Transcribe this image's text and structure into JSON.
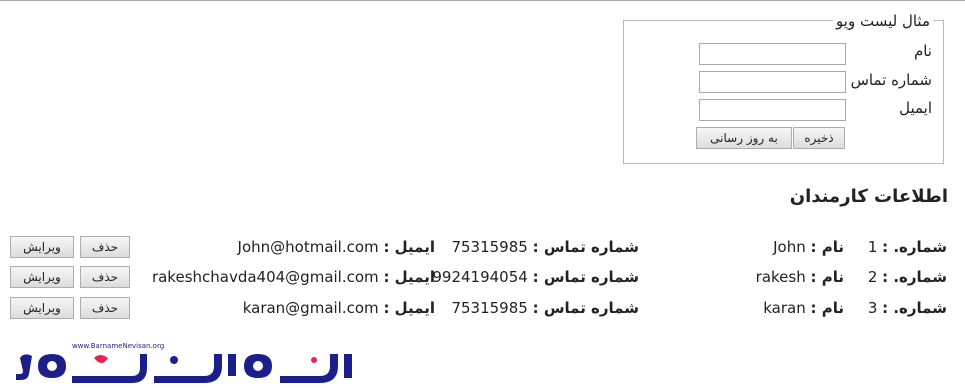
{
  "form": {
    "legend": "مثال لیست ویو",
    "name_label": "نام",
    "phone_label": "شماره تماس",
    "email_label": "ایمیل",
    "name_value": "",
    "phone_value": "",
    "email_value": "",
    "save_label": "ذخیره",
    "update_label": "به روز رسانی"
  },
  "section_title": "اطلاعات کارمندان",
  "labels": {
    "number": "شماره. :",
    "name": "نام :",
    "phone": "شماره تماس :",
    "email": "ایمیل :",
    "delete": "حذف",
    "edit": "ویرایش"
  },
  "employees": [
    {
      "number": "1",
      "name": "John",
      "phone": "75315985",
      "email": "John@hotmail.com"
    },
    {
      "number": "2",
      "name": "rakesh",
      "phone": "9924194054",
      "email": "rakeshchavda404@gmail.com"
    },
    {
      "number": "3",
      "name": "karan",
      "phone": "75315985",
      "email": "karan@gmail.com"
    }
  ],
  "logo": {
    "url_text": "www.BarnameNevisan.org",
    "brand_text": "برنامه نویسان",
    "color": "#1b1f8a",
    "accent": "#e6254f"
  }
}
